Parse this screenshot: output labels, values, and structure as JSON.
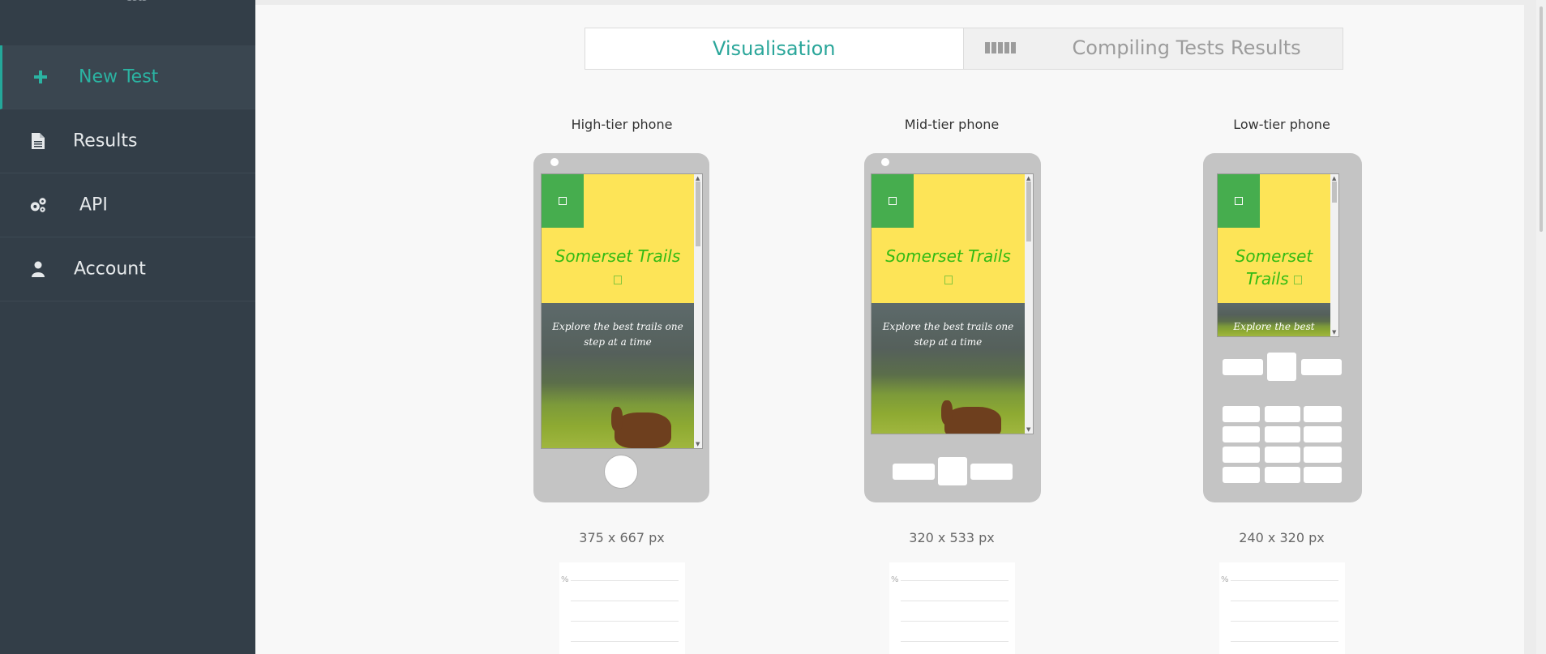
{
  "sidebar": {
    "logo_text": "ests",
    "items": [
      {
        "label": "New Test",
        "icon": "plus-icon",
        "active": true
      },
      {
        "label": "Results",
        "icon": "file-icon",
        "active": false
      },
      {
        "label": "API",
        "icon": "gears-icon",
        "active": false
      },
      {
        "label": "Account",
        "icon": "user-icon",
        "active": false
      }
    ]
  },
  "tabs": {
    "visualisation": "Visualisation",
    "results": "Compiling Tests Results"
  },
  "phones": [
    {
      "title": "High-tier phone",
      "dimensions": "375 x 667 px"
    },
    {
      "title": "Mid-tier phone",
      "dimensions": "320 x 533 px"
    },
    {
      "title": "Low-tier phone",
      "dimensions": "240 x 320 px"
    }
  ],
  "site": {
    "title": "Somerset Trails",
    "title_line1": "Somerset",
    "title_line2": "Trails",
    "tagline": "Explore the best trails one step at a time",
    "tagline_short": "Explore the best trails"
  },
  "chart": {
    "percent_symbol": "%"
  },
  "colors": {
    "sidebar_bg": "#333e48",
    "accent": "#2aa69a",
    "site_header": "#fde457",
    "site_title": "#33bb13",
    "site_green_box": "#46ad4e"
  }
}
